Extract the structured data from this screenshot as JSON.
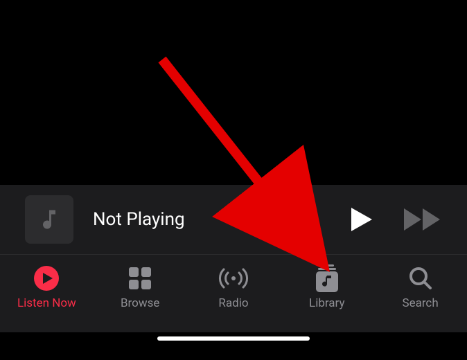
{
  "now_playing": {
    "status_text": "Not Playing"
  },
  "tabs": {
    "listen_now": "Listen Now",
    "browse": "Browse",
    "radio": "Radio",
    "library": "Library",
    "search": "Search"
  },
  "colors": {
    "accent": "#fa2d48",
    "inactive": "#8e8e93",
    "annotation": "#e40000"
  }
}
